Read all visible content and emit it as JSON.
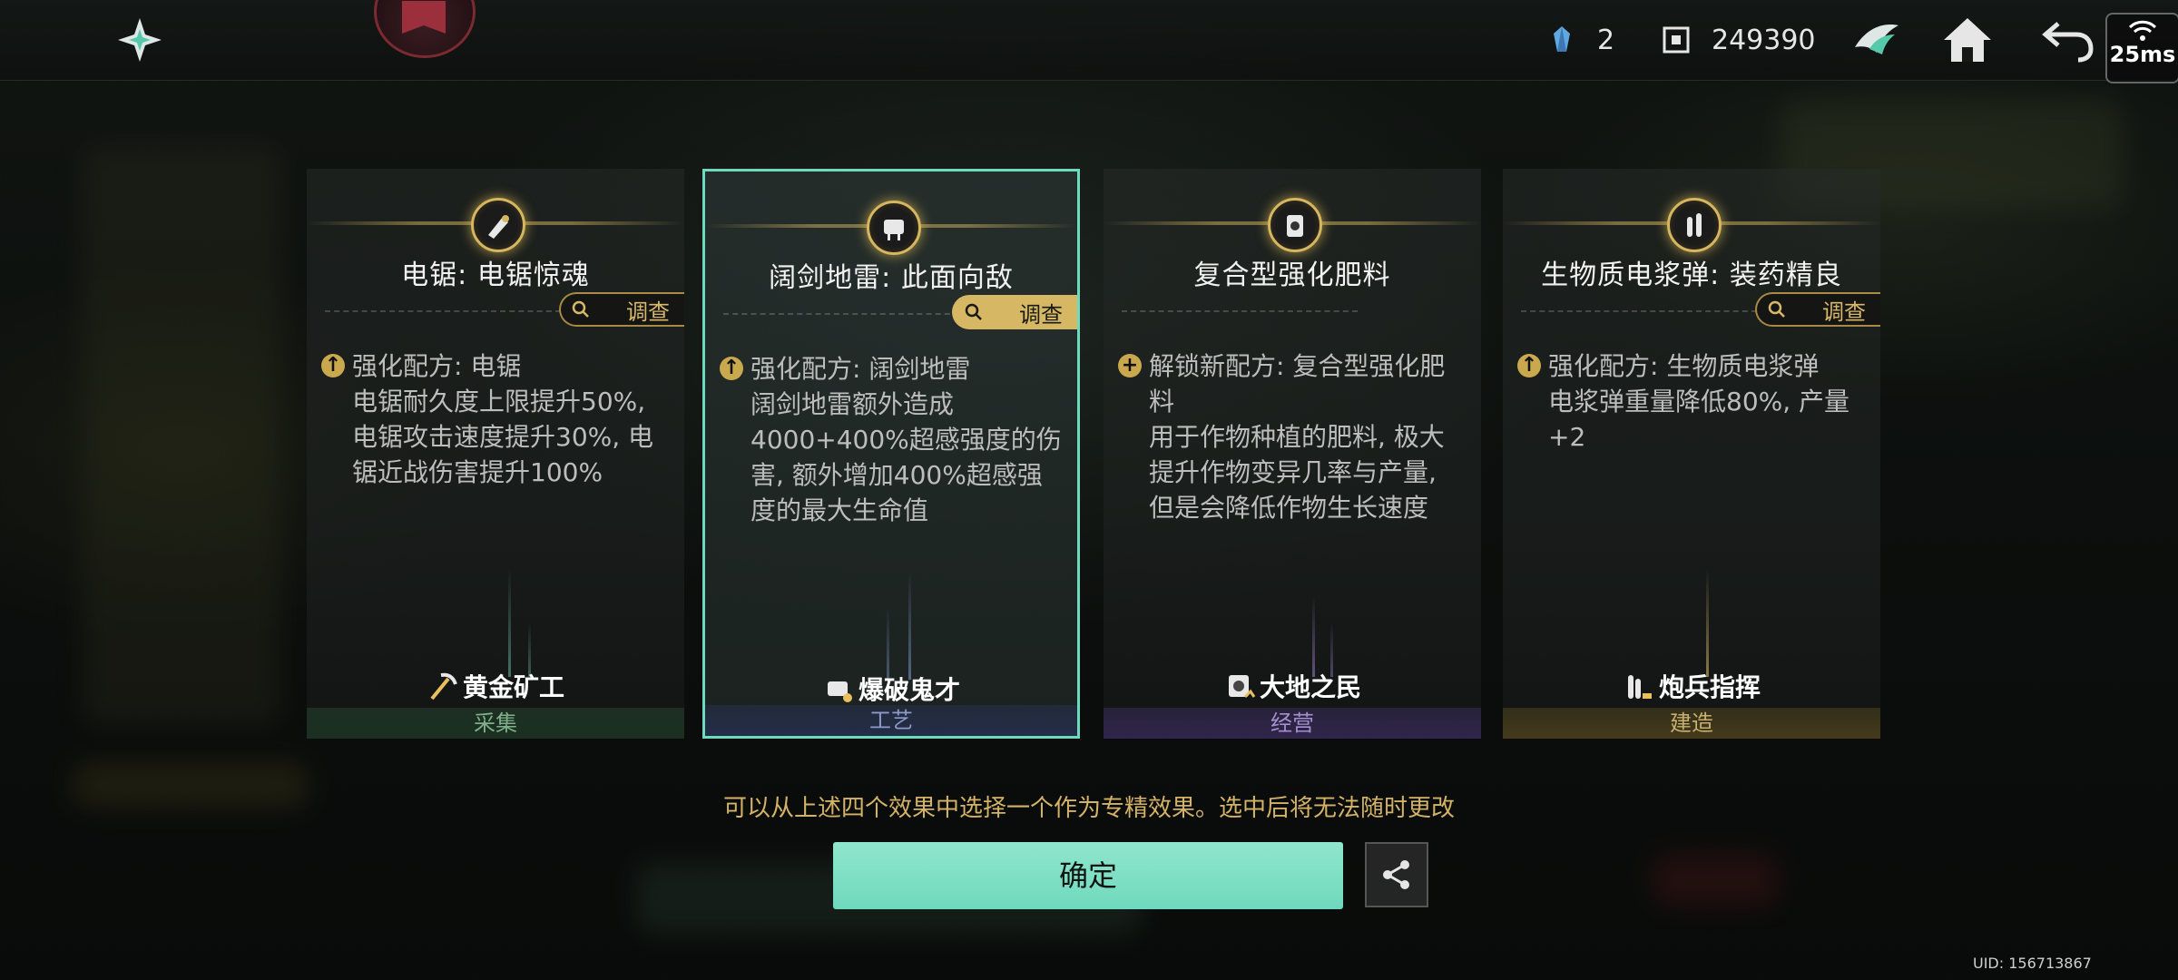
{
  "header": {
    "logo_icon": "shuriken-logo-icon",
    "resources": [
      {
        "icon": "crystal-icon",
        "value": "2"
      },
      {
        "icon": "currency-icon",
        "value": "249390"
      }
    ],
    "ping": "25ms"
  },
  "cards": [
    {
      "title": "电锯: 电锯惊魂",
      "investigate": "调查",
      "desc_head": "强化配方: 电锯",
      "desc_body": "电锯耐久度上限提升50%, 电锯攻击速度提升30%, 电锯近战伤害提升100%",
      "talent": "黄金矿工",
      "category": "采集",
      "selected": false
    },
    {
      "title": "阔剑地雷: 此面向敌",
      "investigate": "调查",
      "desc_head": "强化配方: 阔剑地雷",
      "desc_body": "阔剑地雷额外造成4000+400%超感强度的伤害, 额外增加400%超感强度的最大生命值",
      "talent": "爆破鬼才",
      "category": "工艺",
      "selected": true
    },
    {
      "title": "复合型强化肥料",
      "investigate": "",
      "desc_head": "解锁新配方: 复合型强化肥料",
      "desc_body": "用于作物种植的肥料, 极大提升作物变异几率与产量, 但是会降低作物生长速度",
      "talent": "大地之民",
      "category": "经营",
      "selected": false
    },
    {
      "title": "生物质电浆弹: 装药精良",
      "investigate": "调查",
      "desc_head": "强化配方: 生物质电浆弹",
      "desc_body": "电浆弹重量降低80%, 产量+2",
      "talent": "炮兵指挥",
      "category": "建造",
      "selected": false
    }
  ],
  "hint": "可以从上述四个效果中选择一个作为专精效果。选中后将无法随时更改",
  "confirm_label": "确定",
  "uid": "UID: 156713867",
  "colors": {
    "accent": "#6fd9bd",
    "gold": "#d6b864"
  }
}
